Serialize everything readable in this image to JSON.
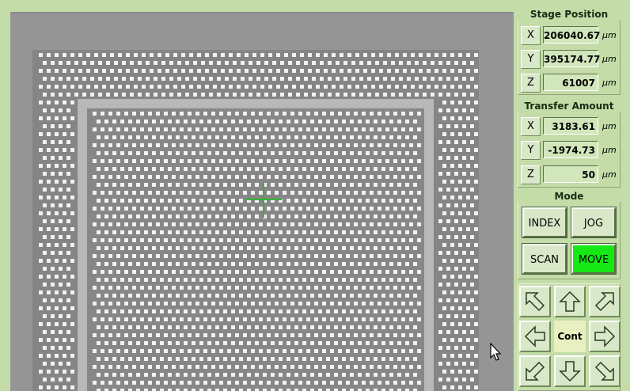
{
  "stage_position": {
    "title": "Stage Position",
    "x_label": "X",
    "x_value": "206040.67",
    "y_label": "Y",
    "y_value": "395174.77",
    "z_label": "Z",
    "z_value": "61007",
    "unit": "µm"
  },
  "transfer_amount": {
    "title": "Transfer Amount",
    "x_label": "X",
    "x_value": "3183.61",
    "y_label": "Y",
    "y_value": "-1974.73",
    "z_label": "Z",
    "z_value": "50",
    "unit": "µm"
  },
  "mode": {
    "title": "Mode",
    "index_label": "INDEX",
    "jog_label": "JOG",
    "scan_label": "SCAN",
    "move_label": "MOVE",
    "active": "MOVE",
    "active_color": "#15e815"
  },
  "jog_pad": {
    "center_label": "Cont"
  },
  "colors": {
    "background": "#c4dca8",
    "crosshair": "#2fb62f"
  }
}
